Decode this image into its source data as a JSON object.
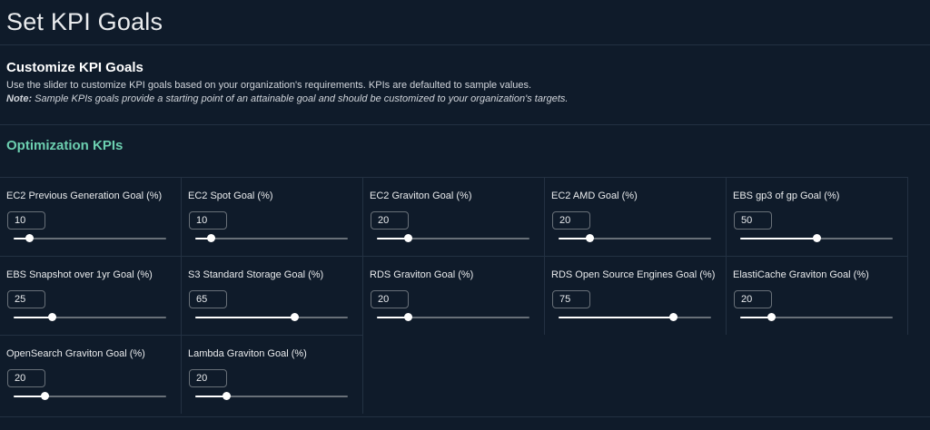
{
  "page": {
    "title": "Set KPI Goals"
  },
  "intro": {
    "heading": "Customize KPI Goals",
    "description": "Use the slider to customize KPI goals based on  your organization's requirements. KPIs are defaulted to sample values.",
    "note_label": "Note:",
    "note_text": " Sample KPIs goals provide a starting point of an attainable goal and should be customized to your organization's targets."
  },
  "section": {
    "heading": "Optimization KPIs"
  },
  "colors": {
    "background": "#0f1b2a",
    "accent": "#6ccfb0",
    "border": "#233142",
    "track": "#687078",
    "thumb": "#ffffff"
  },
  "slider_max": 100,
  "kpis": [
    {
      "label": "EC2 Previous Generation Goal (%)",
      "value": "10",
      "level": 10
    },
    {
      "label": "EC2 Spot Goal (%)",
      "value": "10",
      "level": 10
    },
    {
      "label": "EC2 Graviton Goal (%)",
      "value": "20",
      "level": 20
    },
    {
      "label": "EC2 AMD Goal (%)",
      "value": "20",
      "level": 20
    },
    {
      "label": "EBS gp3 of gp Goal (%)",
      "value": "50",
      "level": 50
    },
    {
      "label": "EBS Snapshot over 1yr Goal (%)",
      "value": "25",
      "level": 25
    },
    {
      "label": "S3 Standard Storage Goal (%)",
      "value": "65",
      "level": 65
    },
    {
      "label": "RDS Graviton Goal (%)",
      "value": "20",
      "level": 20
    },
    {
      "label": "RDS Open Source Engines Goal (%)",
      "value": "75",
      "level": 75
    },
    {
      "label": "ElastiCache Graviton Goal (%)",
      "value": "20",
      "level": 20
    },
    {
      "label": "OpenSearch Graviton Goal (%)",
      "value": "20",
      "level": 20
    },
    {
      "label": "Lambda Graviton Goal (%)",
      "value": "20",
      "level": 20
    }
  ]
}
